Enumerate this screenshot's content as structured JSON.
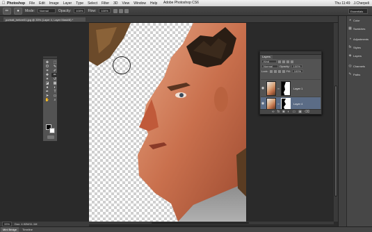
{
  "menubar": {
    "apple": "",
    "app": "Photoshop",
    "items": [
      "File",
      "Edit",
      "Image",
      "Layer",
      "Type",
      "Select",
      "Filter",
      "3D",
      "View",
      "Window",
      "Help"
    ],
    "window_title": "Adobe Photoshop CS6",
    "clock": "Thu 11:49",
    "user": "J.Cherpeli"
  },
  "options": {
    "mode_label": "Mode:",
    "mode_value": "Normal",
    "opacity_label": "Opacity:",
    "opacity_value": "100%",
    "flow_label": "Flow:",
    "flow_value": "100%",
    "workspace": "Essentials"
  },
  "document": {
    "tab": "portrait_before01.jpg @ 33% (Layer 4, Layer Mask/8) *"
  },
  "status": {
    "zoom": "33%",
    "doc": "Doc: 4.92M/11.1M"
  },
  "bottom_tabs": [
    "Mini Bridge",
    "Timeline"
  ],
  "toolbox": {
    "tools": [
      "move-icon",
      "marquee-icon",
      "lasso-icon",
      "quick-select-icon",
      "crop-icon",
      "eyedropper-icon",
      "healing-icon",
      "brush-icon",
      "clone-stamp-icon",
      "history-brush-icon",
      "eraser-icon",
      "gradient-icon",
      "blur-icon",
      "dodge-icon",
      "pen-icon",
      "type-icon",
      "path-select-icon",
      "shape-icon",
      "hand-icon",
      "zoom-icon"
    ],
    "glyphs": [
      "✥",
      "⬚",
      "ʘ",
      "✎",
      "⌗",
      "✐",
      "✚",
      "✏",
      "✦",
      "↺",
      "◪",
      "▦",
      "●",
      "◐",
      "✒",
      "T",
      "➤",
      "▭",
      "✋",
      "⌕"
    ]
  },
  "dock": {
    "items": [
      {
        "label": "Color",
        "icon": "color-icon",
        "glyph": "◕"
      },
      {
        "label": "Swatches",
        "icon": "swatches-icon",
        "glyph": "▦"
      },
      {
        "label": "Adjustments",
        "icon": "adjustments-icon",
        "glyph": "◑"
      },
      {
        "label": "Styles",
        "icon": "styles-icon",
        "glyph": "fx"
      },
      {
        "label": "Layers",
        "icon": "layers-icon",
        "glyph": "◈"
      },
      {
        "label": "Channels",
        "icon": "channels-icon",
        "glyph": "◎"
      },
      {
        "label": "Paths",
        "icon": "paths-icon",
        "glyph": "✎"
      }
    ]
  },
  "layers": {
    "tab": "Layers",
    "kind": "Kind",
    "blend": "Normal",
    "opacity_label": "Opacity:",
    "opacity": "100%",
    "lock_label": "Lock:",
    "fill_label": "Fill:",
    "fill": "100%",
    "rows": [
      {
        "name": "Layer 1",
        "active": false
      },
      {
        "name": "Layer 4",
        "active": true
      }
    ],
    "footer_icons": [
      "link-icon",
      "fx-icon",
      "mask-icon",
      "adjustment-icon",
      "group-icon",
      "new-layer-icon",
      "trash-icon"
    ],
    "footer_glyphs": [
      "∞",
      "fx",
      "◙",
      "◐",
      "▭",
      "▣",
      "⌫"
    ]
  }
}
